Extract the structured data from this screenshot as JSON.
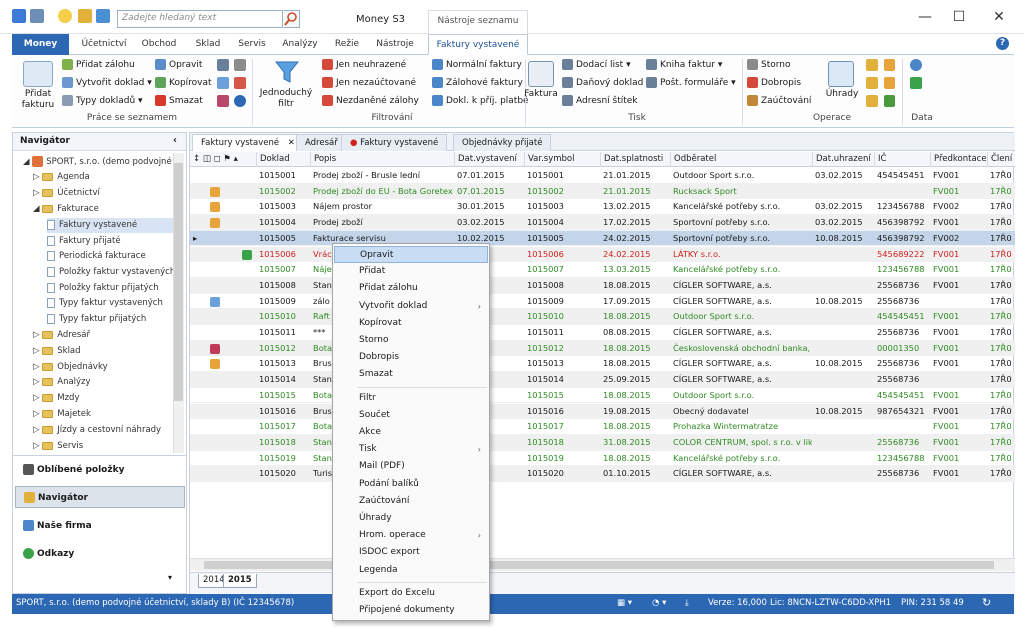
{
  "app": {
    "title": "Money S3",
    "context_tab": "Nástroje seznamu",
    "search_placeholder": "Zadejte hledaný text",
    "btn_min": "—",
    "btn_max": "☐",
    "btn_close": "✕",
    "help": "?"
  },
  "ribbon_tabs": [
    "Money",
    "Účetnictví",
    "Obchod",
    "Sklad",
    "Servis",
    "Analýzy",
    "Režie",
    "Nástroje",
    "Faktury vystavené"
  ],
  "ribbon": {
    "work": {
      "new_btn": "Přidat fakturu",
      "items": [
        "Přidat zálohu",
        "Vytvořit doklad",
        "Typy dokladů",
        "Opravit",
        "Kopírovat",
        "Smazat"
      ],
      "label": "Práce se seznamem"
    },
    "filter": {
      "simple": "Jednoduchý filtr",
      "items": [
        "Jen neuhrazené",
        "Jen nezaúčtované",
        "Nezdaněné zálohy",
        "Normální faktury",
        "Zálohové faktury",
        "Dokl. k příj. platbě"
      ],
      "label": "Filtrování"
    },
    "print": {
      "faktura": "Faktura",
      "items": [
        "Dodací list",
        "Daňový doklad",
        "Adresní štítek",
        "Kniha faktur",
        "Pošt. formuláře"
      ],
      "label": "Tisk"
    },
    "ops": {
      "items": [
        "Storno",
        "Dobropis",
        "Zaúčtování"
      ],
      "uhrady": "Úhrady",
      "label": "Operace"
    },
    "data": {
      "label": "Data"
    }
  },
  "navigator": {
    "title": "Navigátor",
    "tree": [
      "SPORT, s.r.o. (demo podvojné ú",
      "Agenda",
      "Účetnictví",
      "Fakturace",
      "Faktury vystavené",
      "Faktury přijaté",
      "Periodická fakturace",
      "Položky faktur vystavených",
      "Položky faktur přijatých",
      "Typy faktur vystavených",
      "Typy faktur přijatých",
      "Adresář",
      "Sklad",
      "Objednávky",
      "Analýzy",
      "Mzdy",
      "Majetek",
      "Jízdy a cestovní náhrady",
      "Servis"
    ],
    "buttons": [
      "Oblíbené položky",
      "Navigátor",
      "Naše firma",
      "Odkazy"
    ]
  },
  "doc_tabs": [
    "Faktury vystavené",
    "Adresář",
    "Faktury vystavené",
    "Objednávky přijaté"
  ],
  "columns": [
    "Doklad",
    "Popis",
    "Dat.vystavení",
    "Var.symbol",
    "Dat.splatnosti",
    "Odběratel",
    "Dat.uhrazení",
    "IČ",
    "Předkontace",
    "Člení"
  ],
  "rows": [
    [
      "1015001",
      "Prodej zboží - Brusle lední",
      "07.01.2015",
      "1015001",
      "21.01.2015",
      "Outdoor Sport s.r.o.",
      "03.02.2015",
      "454545451",
      "FV001",
      "17Ř0"
    ],
    [
      "1015002",
      "Prodej zboží do EU - Bota Goretex",
      "07.01.2015",
      "1015002",
      "21.01.2015",
      "Rucksack Sport",
      "",
      "",
      "FV001",
      "17Ř0"
    ],
    [
      "1015003",
      "Nájem prostor",
      "30.01.2015",
      "1015003",
      "13.02.2015",
      "Kancelářské potřeby s.r.o.",
      "03.02.2015",
      "123456788",
      "FV002",
      "17Ř0"
    ],
    [
      "1015004",
      "Prodej zboží",
      "03.02.2015",
      "1015004",
      "17.02.2015",
      "Sportovní potřeby s.r.o.",
      "03.02.2015",
      "456398792",
      "FV001",
      "17Ř0"
    ],
    [
      "1015005",
      "Fakturace servisu",
      "10.02.2015",
      "1015005",
      "24.02.2015",
      "Sportovní potřeby s.r.o.",
      "10.08.2015",
      "456398792",
      "FV002",
      "17Ř0"
    ],
    [
      "1015006",
      "Vrác",
      "2015",
      "1015006",
      "24.02.2015",
      "LÁTKY s.r.o.",
      "",
      "545689222",
      "FV001",
      "17Ř0"
    ],
    [
      "1015007",
      "Nájem",
      "2015",
      "1015007",
      "13.03.2015",
      "Kancelářské potřeby s.r.o.",
      "",
      "123456788",
      "FV001",
      "17Ř0"
    ],
    [
      "1015008",
      "Stan",
      "2015",
      "1015008",
      "18.08.2015",
      "CÍGLER SOFTWARE, a.s.",
      "",
      "25568736",
      "FV001",
      "17Ř0"
    ],
    [
      "1015009",
      "zálo",
      "2015",
      "1015009",
      "17.09.2015",
      "CÍGLER SOFTWARE, a.s.",
      "10.08.2015",
      "25568736",
      "",
      "17Ř0"
    ],
    [
      "1015010",
      "Raft",
      "2015",
      "1015010",
      "18.08.2015",
      "Outdoor Sport s.r.o.",
      "",
      "454545451",
      "FV001",
      "17Ř0"
    ],
    [
      "1015011",
      "***",
      "2015",
      "1015011",
      "08.08.2015",
      "CÍGLER SOFTWARE, a.s.",
      "",
      "25568736",
      "FV001",
      "17Ř0"
    ],
    [
      "1015012",
      "Bota",
      "2015",
      "1015012",
      "18.08.2015",
      "Československá obchodní banka, a.",
      "",
      "00001350",
      "FV001",
      "17Ř0"
    ],
    [
      "1015013",
      "Brus",
      "2015",
      "1015013",
      "18.08.2015",
      "CÍGLER SOFTWARE, a.s.",
      "10.08.2015",
      "25568736",
      "FV001",
      "17Ř0"
    ],
    [
      "1015014",
      "Stan",
      "2015",
      "1015014",
      "25.09.2015",
      "CÍGLER SOFTWARE, a.s.",
      "",
      "25568736",
      "",
      "17Ř0"
    ],
    [
      "1015015",
      "Bota",
      "2015",
      "1015015",
      "18.08.2015",
      "Outdoor Sport s.r.o.",
      "",
      "454545451",
      "FV001",
      "17Ř0"
    ],
    [
      "1015016",
      "Brus",
      "2015",
      "1015016",
      "19.08.2015",
      "Obecný dodavatel",
      "10.08.2015",
      "987654321",
      "FV001",
      "17Ř0"
    ],
    [
      "1015017",
      "Bota",
      "2015",
      "1015017",
      "18.08.2015",
      "Prohazka Wintermatratze",
      "",
      "",
      "FV001",
      "17Ř0"
    ],
    [
      "1015018",
      "Stan",
      "2015",
      "1015018",
      "31.08.2015",
      "COLOR CENTRUM, spol. s r.o. v lik",
      "",
      "25568736",
      "FV001",
      "17Ř0"
    ],
    [
      "1015019",
      "Stan",
      "2015",
      "1015019",
      "18.08.2015",
      "Kancelářské potřeby s.r.o.",
      "",
      "123456788",
      "FV001",
      "17Ř0"
    ],
    [
      "1015020",
      "Turis",
      "2015",
      "1015020",
      "01.10.2015",
      "CÍGLER SOFTWARE, a.s.",
      "",
      "25568736",
      "FV001",
      "17Ř0"
    ]
  ],
  "context_menu": [
    "Opravit",
    "Přidat",
    "Přidat zálohu",
    "Vytvořit doklad",
    "Kopírovat",
    "Storno",
    "Dobropis",
    "Smazat",
    "Filtr",
    "Součet",
    "Akce",
    "Tisk",
    "Mail (PDF)",
    "Podání balíků",
    "Zaúčtování",
    "Úhrady",
    "Hrom. operace",
    "ISDOC export",
    "Legenda",
    "Export do Excelu",
    "Připojené dokumenty"
  ],
  "year_tabs": [
    "2014",
    "2015"
  ],
  "status": {
    "company": "SPORT, s.r.o. (demo podvojné účetnictví, sklady B) (IČ 12345678)",
    "version": "Verze: 16,000",
    "lic": "Lic: 8NCN-LZTW-C6DD-XPH1",
    "pin": "PIN: 231 58 49"
  },
  "colors": {
    "accent": "#2c67b4",
    "green": "#2e8b22",
    "red": "#d0201c",
    "selected": "#c4d5ea"
  }
}
